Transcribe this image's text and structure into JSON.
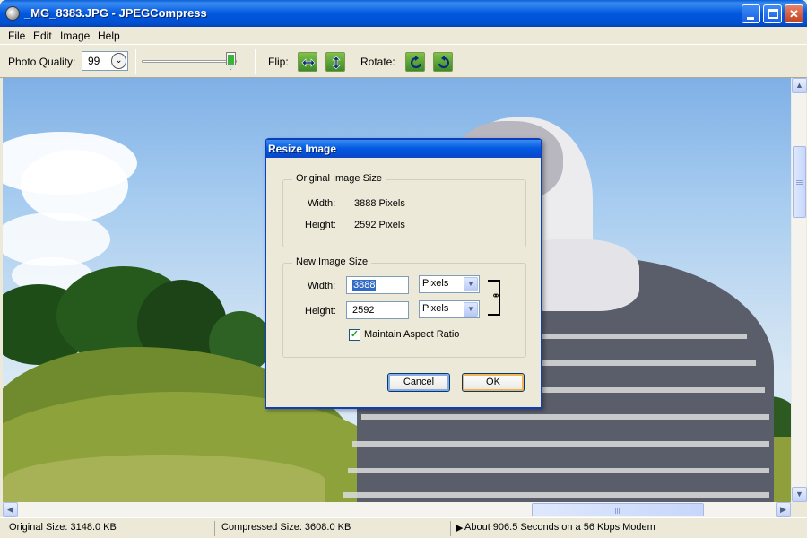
{
  "window": {
    "title": "_MG_8383.JPG - JPEGCompress"
  },
  "menu": {
    "items": [
      "File",
      "Edit",
      "Image",
      "Help"
    ]
  },
  "toolbar": {
    "photo_quality_label": "Photo Quality:",
    "photo_quality_value": "99",
    "flip_label": "Flip:",
    "rotate_label": "Rotate:",
    "quality_slider_level": 0.99
  },
  "dialog": {
    "title": "Resize Image",
    "original": {
      "group_label": "Original Image Size",
      "width_label": "Width:",
      "width_value": "3888 Pixels",
      "height_label": "Height:",
      "height_value": "2592 Pixels"
    },
    "new": {
      "group_label": "New Image Size",
      "width_label": "Width:",
      "width_value": "3888",
      "height_label": "Height:",
      "height_value": "2592",
      "width_unit": "Pixels",
      "height_unit": "Pixels",
      "maintain_aspect_label": "Maintain Aspect Ratio",
      "maintain_aspect_checked": true
    },
    "cancel_label": "Cancel",
    "ok_label": "OK"
  },
  "status": {
    "original_size": "Original Size: 3148.0 KB",
    "compressed_size": "Compressed Size: 3608.0 KB",
    "download_time": "About 906.5 Seconds on a 56 Kbps Modem"
  }
}
